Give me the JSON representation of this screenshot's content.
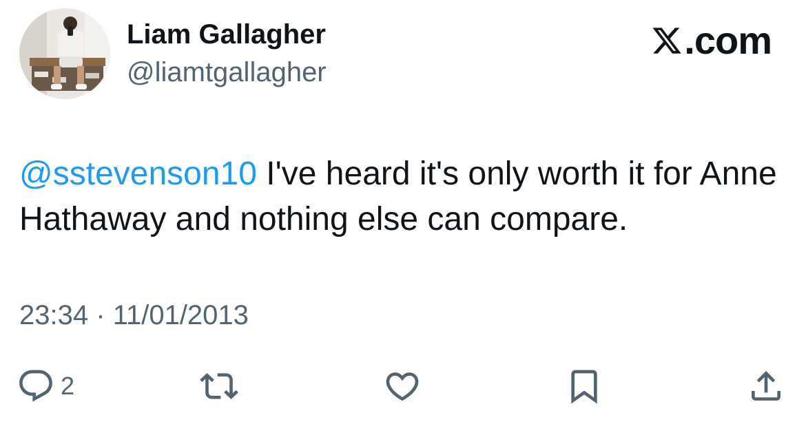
{
  "author": {
    "display_name": "Liam Gallagher",
    "handle": "@liamtgallagher",
    "avatar_icon": "profile-photo"
  },
  "brand": {
    "logo_icon": "x-logo-icon",
    "text": ".com"
  },
  "tweet": {
    "mention": "@sstevenson10",
    "body": " I've heard it's only worth it for Anne Hathaway and nothing else can compare."
  },
  "meta": {
    "time": "23:34",
    "separator": "·",
    "date": "11/01/2013"
  },
  "actions": {
    "reply": {
      "icon": "reply-icon",
      "count": "2"
    },
    "retweet": {
      "icon": "retweet-icon"
    },
    "like": {
      "icon": "heart-icon"
    },
    "bookmark": {
      "icon": "bookmark-icon"
    },
    "share": {
      "icon": "share-icon"
    }
  },
  "colors": {
    "text": "#0f1419",
    "secondary": "#536471",
    "link": "#1d9bf0"
  }
}
